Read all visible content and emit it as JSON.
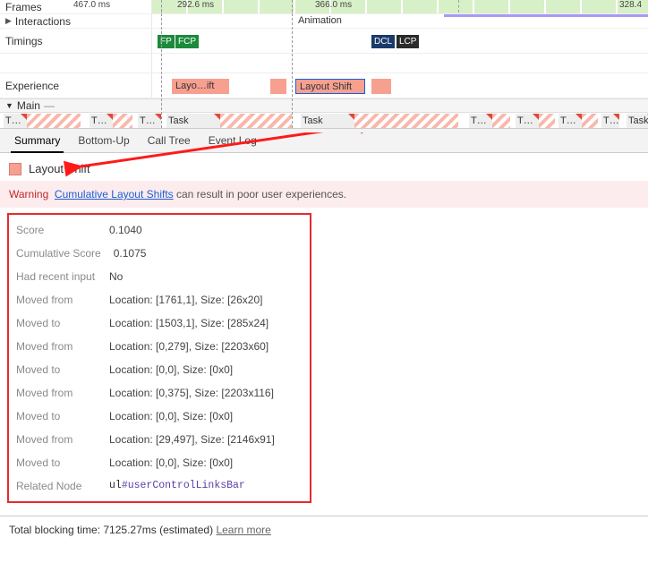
{
  "frames_row": {
    "label": "Frames",
    "times": [
      "467.0 ms",
      "292.6 ms",
      "366.0 ms",
      "328.4"
    ]
  },
  "interactions_row": {
    "label": "Interactions",
    "animation_label": "Animation"
  },
  "timings_row": {
    "label": "Timings",
    "tags": {
      "fp": "FP",
      "fcp": "FCP",
      "dcl": "DCL",
      "lcp": "LCP"
    }
  },
  "experience_row": {
    "label": "Experience",
    "blocks": {
      "first": "Layo…ift",
      "selected": "Layout Shift"
    }
  },
  "main_row": {
    "label": "Main",
    "task_label": "Task",
    "short": "T…"
  },
  "tabs": {
    "summary": "Summary",
    "bottom_up": "Bottom-Up",
    "call_tree": "Call Tree",
    "event_log": "Event Log"
  },
  "summary": {
    "title": "Layout Shift",
    "warning_prefix": "Warning",
    "warning_link": "Cumulative Layout Shifts",
    "warning_rest": "can result in poor user experiences.",
    "details": [
      {
        "k": "Score",
        "v": "0.1040"
      },
      {
        "k": "Cumulative Score",
        "v": "0.1075"
      },
      {
        "k": "Had recent input",
        "v": "No"
      },
      {
        "k": "Moved from",
        "v": "Location: [1761,1], Size: [26x20]"
      },
      {
        "k": "Moved to",
        "v": "Location: [1503,1], Size: [285x24]"
      },
      {
        "k": "Moved from",
        "v": "Location: [0,279], Size: [2203x60]"
      },
      {
        "k": "Moved to",
        "v": "Location: [0,0], Size: [0x0]"
      },
      {
        "k": "Moved from",
        "v": "Location: [0,375], Size: [2203x116]"
      },
      {
        "k": "Moved to",
        "v": "Location: [0,0], Size: [0x0]"
      },
      {
        "k": "Moved from",
        "v": "Location: [29,497], Size: [2146x91]"
      },
      {
        "k": "Moved to",
        "v": "Location: [0,0], Size: [0x0]"
      }
    ],
    "related_label": "Related Node",
    "related_tag": "ul",
    "related_id": "#userControlLinksBar"
  },
  "footer": {
    "text": "Total blocking time: 7125.27ms (estimated)",
    "learn": "Learn more"
  }
}
